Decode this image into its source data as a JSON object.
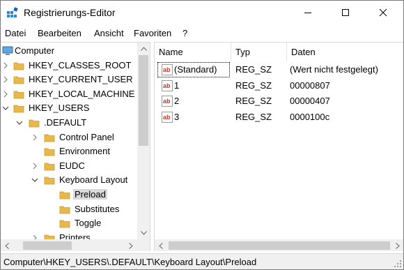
{
  "window": {
    "title": "Registrierungs-Editor"
  },
  "menu": [
    "Datei",
    "Bearbeiten",
    "Ansicht",
    "Favoriten",
    "?"
  ],
  "tree": {
    "root_label": "Computer",
    "items": [
      {
        "label": "HKEY_CLASSES_ROOT",
        "level": 1,
        "expander": "collapsed"
      },
      {
        "label": "HKEY_CURRENT_USER",
        "level": 1,
        "expander": "collapsed"
      },
      {
        "label": "HKEY_LOCAL_MACHINE",
        "level": 1,
        "expander": "collapsed"
      },
      {
        "label": "HKEY_USERS",
        "level": 1,
        "expander": "expanded"
      },
      {
        "label": ".DEFAULT",
        "level": 2,
        "expander": "expanded"
      },
      {
        "label": "Control Panel",
        "level": 3,
        "expander": "collapsed"
      },
      {
        "label": "Environment",
        "level": 3,
        "expander": "none"
      },
      {
        "label": "EUDC",
        "level": 3,
        "expander": "collapsed"
      },
      {
        "label": "Keyboard Layout",
        "level": 3,
        "expander": "expanded"
      },
      {
        "label": "Preload",
        "level": 4,
        "expander": "none",
        "selected": true
      },
      {
        "label": "Substitutes",
        "level": 4,
        "expander": "none"
      },
      {
        "label": "Toggle",
        "level": 4,
        "expander": "none"
      },
      {
        "label": "Printers",
        "level": 3,
        "expander": "collapsed"
      }
    ]
  },
  "values": {
    "columns": {
      "name": "Name",
      "type": "Typ",
      "data": "Daten"
    },
    "rows": [
      {
        "name": "(Standard)",
        "type": "REG_SZ",
        "data": "(Wert nicht festgelegt)",
        "focused": true
      },
      {
        "name": "1",
        "type": "REG_SZ",
        "data": "00000807"
      },
      {
        "name": "2",
        "type": "REG_SZ",
        "data": "00000407"
      },
      {
        "name": "3",
        "type": "REG_SZ",
        "data": "0000100c"
      }
    ]
  },
  "statusbar": {
    "path": "Computer\\HKEY_USERS\\.DEFAULT\\Keyboard Layout\\Preload"
  },
  "colors": {
    "folder": "#e8b84a",
    "folder_dark": "#c99a2e",
    "selection": "#d9d9d9",
    "icon_red": "#c0392b",
    "app_icon": "#1e88e5"
  }
}
